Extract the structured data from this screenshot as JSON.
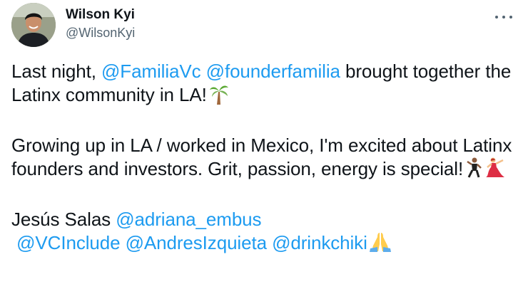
{
  "author": {
    "display_name": "Wilson Kyi",
    "handle": "@WilsonKyi",
    "avatar_icon": "avatar-photo"
  },
  "more_icon": "ellipsis-icon",
  "tweet": {
    "p1": {
      "t1": "Last night, ",
      "m1": "@FamiliaVc",
      "t2": " ",
      "m2": "@founderfamilia",
      "t3": " brought together the Latinx community in LA!",
      "emoji1": "palm-tree-icon"
    },
    "p2": {
      "t1": "Growing up in LA / worked in Mexico, I'm excited about Latinx founders and investors. Grit, passion, energy is special!",
      "emoji1": "man-dancing-icon",
      "emoji2": "woman-dancing-icon"
    },
    "p3": {
      "t1": "Jesús Salas ",
      "m1": "@adriana_embus",
      "m2": "@VCInclude",
      "t2": " ",
      "m3": "@AndresIzquieta",
      "t3": " ",
      "m4": "@drinkchiki",
      "emoji1": "folded-hands-icon"
    }
  },
  "colors": {
    "text": "#0f1419",
    "secondary": "#536471",
    "link": "#1d9bf0",
    "background": "#ffffff"
  }
}
